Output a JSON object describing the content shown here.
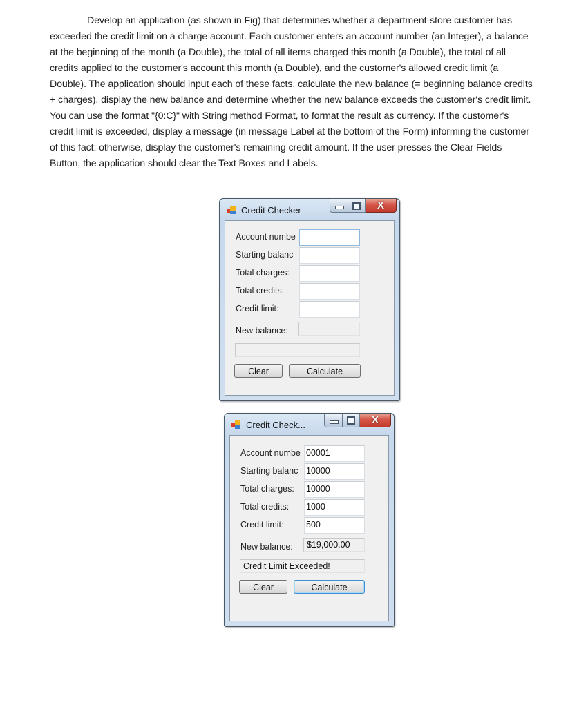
{
  "document": {
    "paragraph": "Develop an application (as shown in Fig) that determines whether a department-store customer has exceeded the credit limit on a charge account. Each customer enters an account number (an Integer), a balance at the beginning of the month (a Double), the total of all items charged this month (a Double), the total of all credits applied to the customer's account this month (a Double), and the customer's allowed credit limit (a Double). The application should input each of these facts, calculate the new balance (= beginning balance credits + charges), display the new balance and determine whether the new balance exceeds the customer's credit limit. You can use the format \"{0:C}\" with String method Format, to format the result as currency. If the customer's credit limit is exceeded, display a message (in message Label at the bottom of the Form) informing the customer of this fact; otherwise, display the customer's remaining credit amount. If the user presses the Clear Fields Button, the application should clear the Text Boxes and Labels."
  },
  "windows": [
    {
      "title": "Credit Checker",
      "icons": {
        "app": "app-form-icon",
        "minimize": "minimize-icon",
        "maximize": "maximize-icon",
        "close": "close-icon"
      },
      "close_glyph": "X",
      "labels": {
        "account_number": "Account numbe",
        "starting_balance": "Starting balanc",
        "total_charges": "Total charges:",
        "total_credits": "Total credits:",
        "credit_limit": "Credit limit:",
        "new_balance": "New balance:"
      },
      "values": {
        "account_number": "",
        "starting_balance": "",
        "total_charges": "",
        "total_credits": "",
        "credit_limit": "",
        "new_balance": "",
        "message": ""
      },
      "buttons": {
        "clear": "Clear",
        "calculate": "Calculate"
      }
    },
    {
      "title": "Credit Check...",
      "icons": {
        "app": "app-form-icon",
        "minimize": "minimize-icon",
        "maximize": "maximize-icon",
        "close": "close-icon"
      },
      "close_glyph": "X",
      "labels": {
        "account_number": "Account numbe",
        "starting_balance": "Starting balanc",
        "total_charges": "Total charges:",
        "total_credits": "Total credits:",
        "credit_limit": "Credit limit:",
        "new_balance": "New balance:"
      },
      "values": {
        "account_number": "00001",
        "starting_balance": "10000",
        "total_charges": "10000",
        "total_credits": "1000",
        "credit_limit": "500",
        "new_balance": "$19,000.00",
        "message": "Credit Limit Exceeded!"
      },
      "buttons": {
        "clear": "Clear",
        "calculate": "Calculate"
      }
    }
  ]
}
